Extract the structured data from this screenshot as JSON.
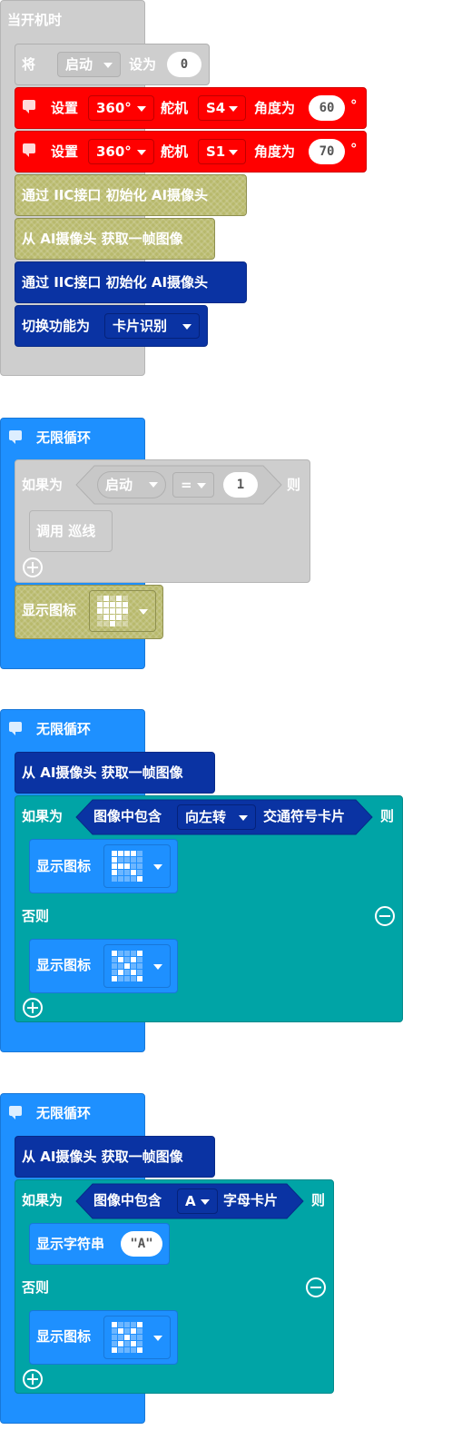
{
  "start_block": {
    "hat_label": "当开机时",
    "set_var": {
      "prefix": "将",
      "variable": "启动",
      "mid": "设为",
      "value": "0"
    },
    "servo_1": {
      "prefix": "设置",
      "type": "360°",
      "mid1": "舵机",
      "port": "S4",
      "mid2": "角度为",
      "value": "60",
      "unit": "°"
    },
    "servo_2": {
      "prefix": "设置",
      "type": "360°",
      "mid1": "舵机",
      "port": "S1",
      "mid2": "角度为",
      "value": "70",
      "unit": "°"
    },
    "init_iic_disabled": "通过 IIC接口 初始化 AI摄像头",
    "get_frame_disabled": "从 AI摄像头 获取一帧图像",
    "init_iic": "通过 IIC接口 初始化 AI摄像头",
    "switch_func": {
      "prefix": "切换功能为",
      "option": "卡片识别"
    }
  },
  "loop_1": {
    "hat_label": "无限循环",
    "if_label": "如果为",
    "cond_var": "启动",
    "cond_op": "=",
    "cond_val": "1",
    "then_label": "则",
    "call_label": "调用 巡线",
    "show_icon_label": "显示图标"
  },
  "loop_2": {
    "hat_label": "无限循环",
    "get_frame": "从 AI摄像头 获取一帧图像",
    "if_label": "如果为",
    "cond_prefix": "图像中包含",
    "cond_option": "向左转",
    "cond_suffix": "交通符号卡片",
    "then_label": "则",
    "show_icon_1": "显示图标",
    "else_label": "否则",
    "show_icon_2": "显示图标"
  },
  "loop_3": {
    "hat_label": "无限循环",
    "get_frame": "从 AI摄像头 获取一帧图像",
    "if_label": "如果为",
    "cond_prefix": "图像中包含",
    "cond_option": "A",
    "cond_suffix": "字母卡片",
    "then_label": "则",
    "show_string_label": "显示字符串",
    "show_string_value": "\"A\"",
    "else_label": "否则",
    "show_icon": "显示图标"
  },
  "colors": {
    "grey": "#cecece",
    "red": "#ff0000",
    "olive": "#b8b96c",
    "navy": "#0a33a3",
    "blue": "#1e90ff",
    "teal": "#00a4a6"
  },
  "icons": {
    "heart": [
      0,
      1,
      0,
      1,
      0,
      1,
      1,
      1,
      1,
      1,
      1,
      1,
      1,
      1,
      1,
      0,
      1,
      1,
      1,
      0,
      0,
      0,
      1,
      0,
      0
    ],
    "arrow_icon": [
      1,
      1,
      1,
      1,
      0,
      1,
      0,
      0,
      0,
      0,
      1,
      1,
      1,
      0,
      0,
      1,
      0,
      0,
      1,
      0,
      0,
      0,
      0,
      0,
      1
    ],
    "cross_icon_1": [
      1,
      0,
      0,
      0,
      1,
      0,
      1,
      0,
      1,
      0,
      0,
      0,
      1,
      0,
      0,
      0,
      1,
      0,
      1,
      0,
      1,
      0,
      0,
      0,
      1
    ],
    "cross_icon_2": [
      1,
      0,
      0,
      0,
      1,
      0,
      1,
      0,
      1,
      0,
      0,
      0,
      1,
      0,
      0,
      0,
      1,
      0,
      1,
      0,
      1,
      0,
      0,
      0,
      1
    ]
  }
}
